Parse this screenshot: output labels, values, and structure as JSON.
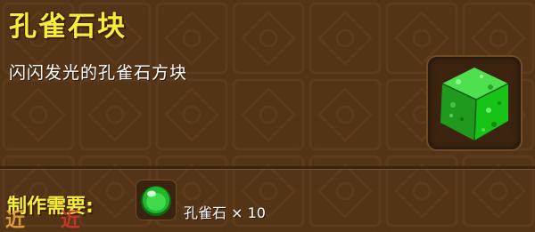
{
  "item": {
    "name": "孔雀石块",
    "description": "闪闪发光的孔雀石方块",
    "icon": "malachite-block-icon"
  },
  "crafting": {
    "label": "制作需要:",
    "ingredients": [
      {
        "name": "孔雀石",
        "quantity_text": "× 10",
        "icon": "malachite-gem-icon"
      }
    ]
  },
  "watermark": {
    "left": "近",
    "right": "近"
  },
  "colors": {
    "title": "#f7ec3c",
    "panel": "#5a3a1c",
    "gem_green": "#2fbf2f"
  }
}
